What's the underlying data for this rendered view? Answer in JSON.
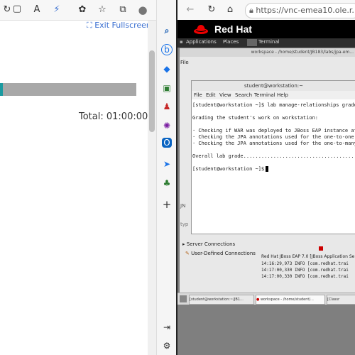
{
  "left_browser": {
    "exit_fullscreen": "Exit Fullscreen",
    "total": "Total: 01:00:00",
    "progress_fraction": 0.02,
    "badge_count": "0"
  },
  "right_browser": {
    "url": "https://vnc-emea10.ole.r..."
  },
  "vnc": {
    "brand": "Red Hat",
    "menubar": {
      "applications": "Applications",
      "places": "Places",
      "terminal": "Terminal"
    },
    "eclipse_title": "workspace - /home/student/JB183/labs/jpa-em...",
    "eclipse_file_menu": "File",
    "terminal": {
      "title": "student@workstation:~",
      "menu": [
        "File",
        "Edit",
        "View",
        "Search",
        "Terminal",
        "Help"
      ],
      "lines": [
        "[student@workstation ~]$ lab manage-relationships grade",
        "",
        "Grading the student's work on workstation:",
        "",
        " · Checking if WAR was deployed to JBoss EAP instance at",
        " · Checking the JPA annotations used for the one-to-one",
        " · Checking the JPA annotations used for the one-to-many",
        "",
        "Overall lab grade.......................................",
        "",
        "[student@workstation ~]$ "
      ]
    },
    "eclipse": {
      "server_connections": "Server Connections",
      "user_defined_connections": "User-Defined Connections",
      "console_header": "Red Hat JBoss EAP 7.0 [JBoss Application Se",
      "console_lines": [
        "14:16:29,973 INFO  [com.redhat.trai",
        "14:17:00,330 INFO  [com.redhat.trai",
        "14:17:00,330 INFO  [com.redhat.trai"
      ],
      "typing_stub": "typ",
      "jn_stub": "JN"
    },
    "taskbar": [
      "[student@workstation:~/JB1...",
      "workspace - /home/student/...",
      "[Classr"
    ]
  }
}
